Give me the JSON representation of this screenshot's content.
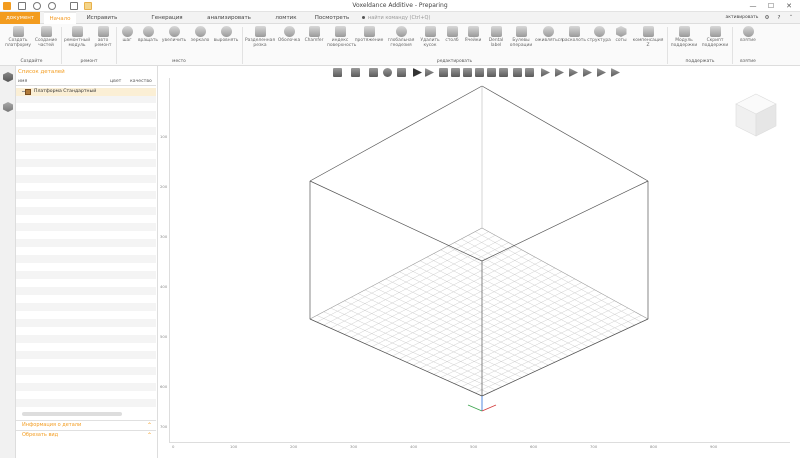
{
  "window": {
    "title": "Voxeldance Additive - Preparing",
    "buttons": [
      "—",
      "☐",
      "✕"
    ]
  },
  "menu": {
    "tabs": [
      {
        "label": "документ"
      },
      {
        "label": "Начало"
      },
      {
        "label": "Исправить"
      },
      {
        "label": "Генерация поддержки"
      },
      {
        "label": "анализировать"
      },
      {
        "label": "ломтик"
      },
      {
        "label": "Посмотреть"
      }
    ],
    "search_placeholder": "найти команду (Ctrl+Q)",
    "user_label": "активировать"
  },
  "ribbon": {
    "buttons": [
      {
        "label": "Создать платформу"
      },
      {
        "label": "Создание частей"
      },
      {
        "label": "ремонтный модуль"
      },
      {
        "label": "авто ремонт"
      },
      {
        "label": "шаг"
      },
      {
        "label": "вращать"
      },
      {
        "label": "увеличить"
      },
      {
        "label": "зеркало"
      },
      {
        "label": "выровнять"
      },
      {
        "label": "Разделенная резка"
      },
      {
        "label": "Оболочка"
      },
      {
        "label": "Chamfer"
      },
      {
        "label": "индекс поверхность"
      },
      {
        "label": "протяжение"
      },
      {
        "label": "глобальная геодезия"
      },
      {
        "label": "Удалить кусок"
      },
      {
        "label": "столб"
      },
      {
        "label": "Ячейки"
      },
      {
        "label": "Dental label"
      },
      {
        "label": "Булевы операции"
      },
      {
        "label": "оживляться"
      },
      {
        "label": "расколоть"
      },
      {
        "label": "структура"
      },
      {
        "label": "соты"
      },
      {
        "label": "компенсация Z"
      },
      {
        "label": "Модуль поддержки"
      },
      {
        "label": "Скрипт поддержки"
      },
      {
        "label": "взятие"
      }
    ],
    "groups": [
      {
        "label": "Создайте"
      },
      {
        "label": "ремонт"
      },
      {
        "label": "место"
      },
      {
        "label": "редактировать"
      },
      {
        "label": "поддержать"
      },
      {
        "label": "взятие"
      }
    ]
  },
  "panel": {
    "title": "Список деталей",
    "columns": [
      "имя",
      "цвет",
      "качество"
    ],
    "part_name": "Платформа Стандартный",
    "accordions": [
      {
        "label": "Информация о детали"
      },
      {
        "label": "Обрезать вид"
      }
    ]
  },
  "viewport": {
    "hruler_ticks": [
      "0",
      "100",
      "200",
      "300",
      "400",
      "500",
      "600",
      "700",
      "800",
      "900"
    ],
    "vruler_ticks": [
      "100",
      "200",
      "300",
      "400",
      "500",
      "600",
      "700"
    ]
  },
  "colors": {
    "accent": "#f39c1f",
    "selected_row": "#fbefd5"
  }
}
